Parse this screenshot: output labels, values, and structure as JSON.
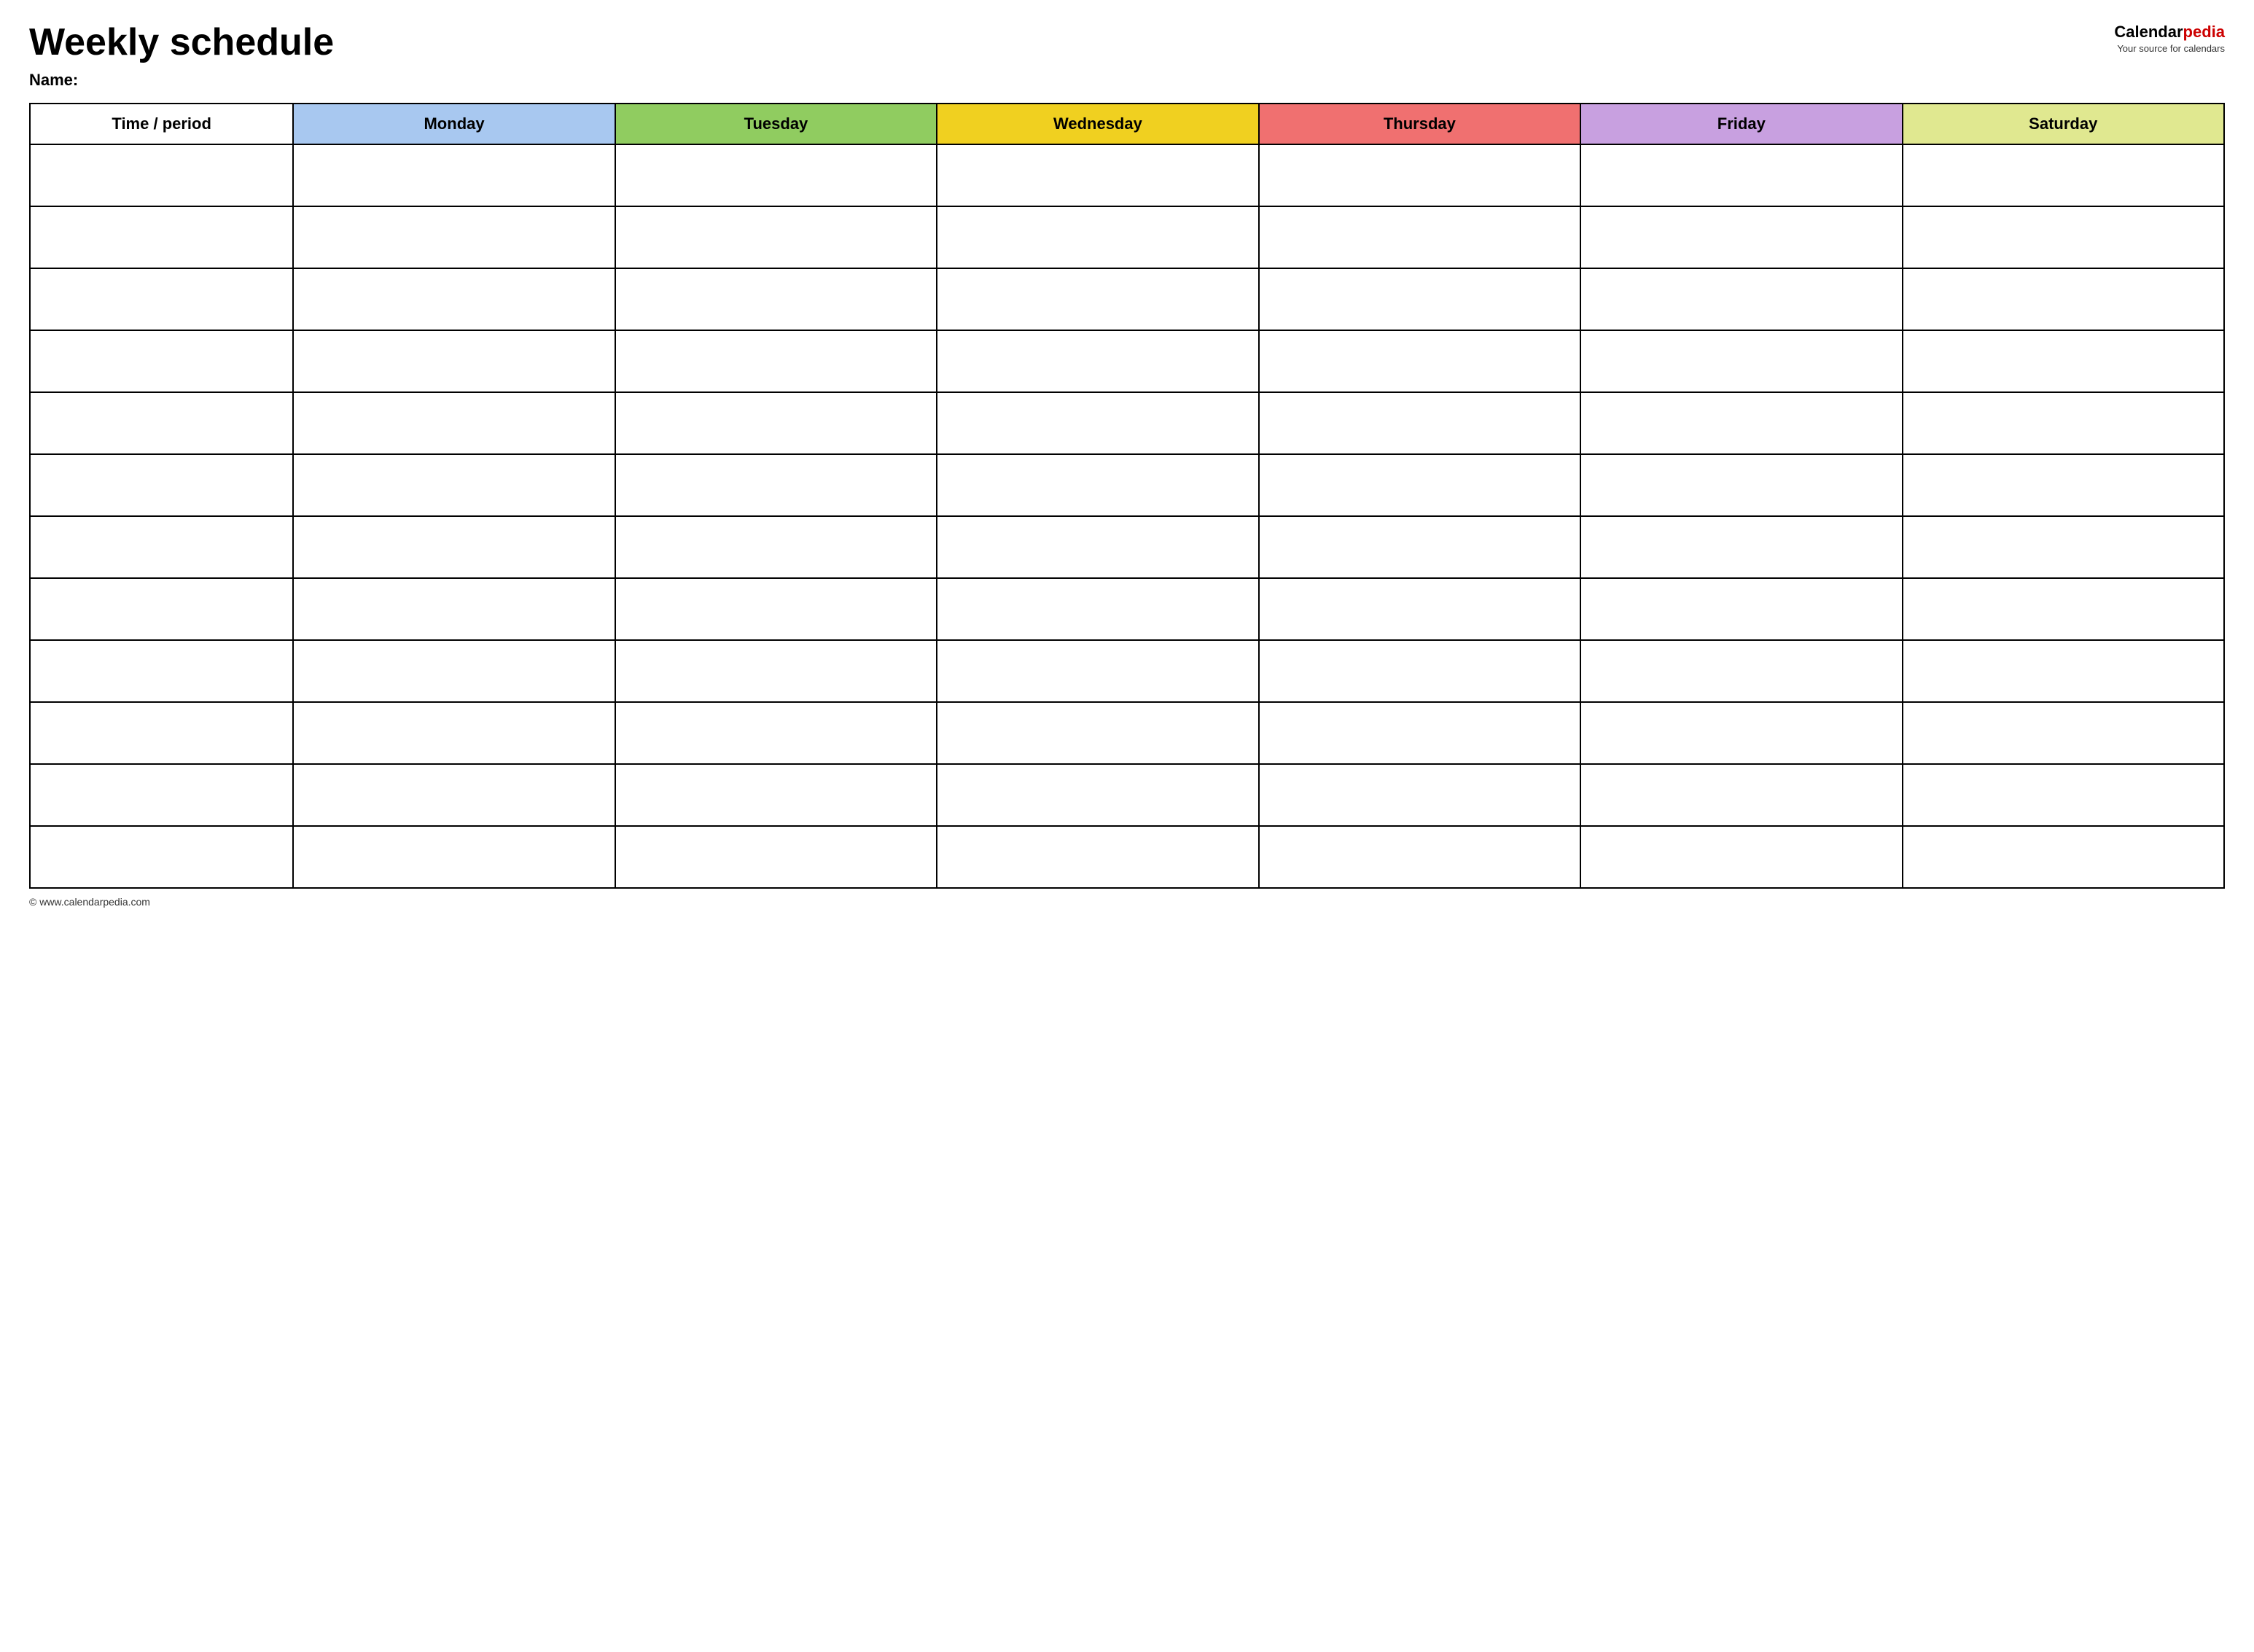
{
  "header": {
    "title": "Weekly schedule",
    "name_label": "Name:",
    "logo_text_calendar": "Calendar",
    "logo_text_pedia": "pedia",
    "logo_tagline": "Your source for calendars",
    "footer_url": "© www.calendarpedia.com"
  },
  "table": {
    "columns": [
      {
        "id": "time",
        "label": "Time / period",
        "color_class": "col-time"
      },
      {
        "id": "monday",
        "label": "Monday",
        "color_class": "col-monday"
      },
      {
        "id": "tuesday",
        "label": "Tuesday",
        "color_class": "col-tuesday"
      },
      {
        "id": "wednesday",
        "label": "Wednesday",
        "color_class": "col-wednesday"
      },
      {
        "id": "thursday",
        "label": "Thursday",
        "color_class": "col-thursday"
      },
      {
        "id": "friday",
        "label": "Friday",
        "color_class": "col-friday"
      },
      {
        "id": "saturday",
        "label": "Saturday",
        "color_class": "col-saturday"
      }
    ],
    "row_count": 12
  }
}
